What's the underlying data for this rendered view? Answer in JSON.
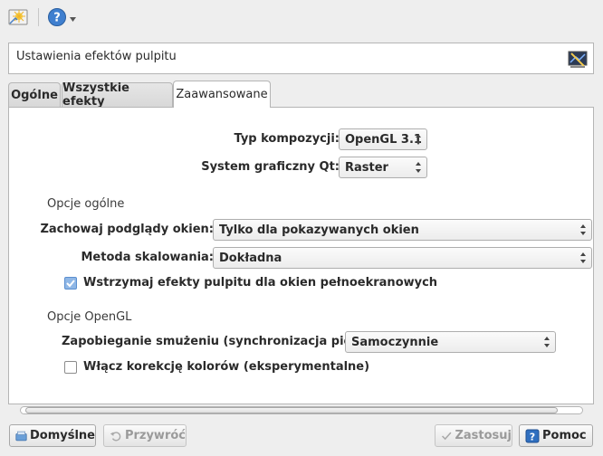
{
  "toolbar": {
    "effects_icon": "desktop-effects-icon",
    "help_icon": "help-icon",
    "help_dropdown_icon": "chevron-down-icon"
  },
  "header": {
    "title": "Ustawienia efektów pulpitu",
    "icon": "desktop-effects-settings-icon"
  },
  "tabs": [
    {
      "label": "Ogólne"
    },
    {
      "label": "Wszystkie efekty"
    },
    {
      "label": "Zaawansowane"
    }
  ],
  "advanced": {
    "compositing_type_label": "Typ kompozycji:",
    "compositing_type_value": "OpenGL 3.1",
    "qt_graphics_label": "System graficzny Qt:",
    "qt_graphics_value": "Raster",
    "general_section": "Opcje ogólne",
    "keep_previews_label": "Zachowaj podglądy okien:",
    "keep_previews_value": "Tylko dla pokazywanych okien",
    "scale_method_label": "Metoda skalowania:",
    "scale_method_value": "Dokładna",
    "suspend_fullscreen_label": "Wstrzymaj efekty pulpitu dla okien pełnoekranowych",
    "suspend_fullscreen_checked": true,
    "opengl_section": "Opcje OpenGL",
    "tearing_label": "Zapobieganie smużeniu (synchronizacja pionowa)",
    "tearing_value": "Samoczynnie",
    "color_correction_label": "Włącz korekcję kolorów (eksperymentalne)",
    "color_correction_checked": false
  },
  "buttons": {
    "defaults": "Domyślne",
    "reset": "Przywróć",
    "apply": "Zastosuj",
    "help": "Pomoc"
  },
  "colors": {
    "accent": "#5b8fcf",
    "panel_bg": "#ffffff",
    "window_bg": "#eeeeee"
  }
}
